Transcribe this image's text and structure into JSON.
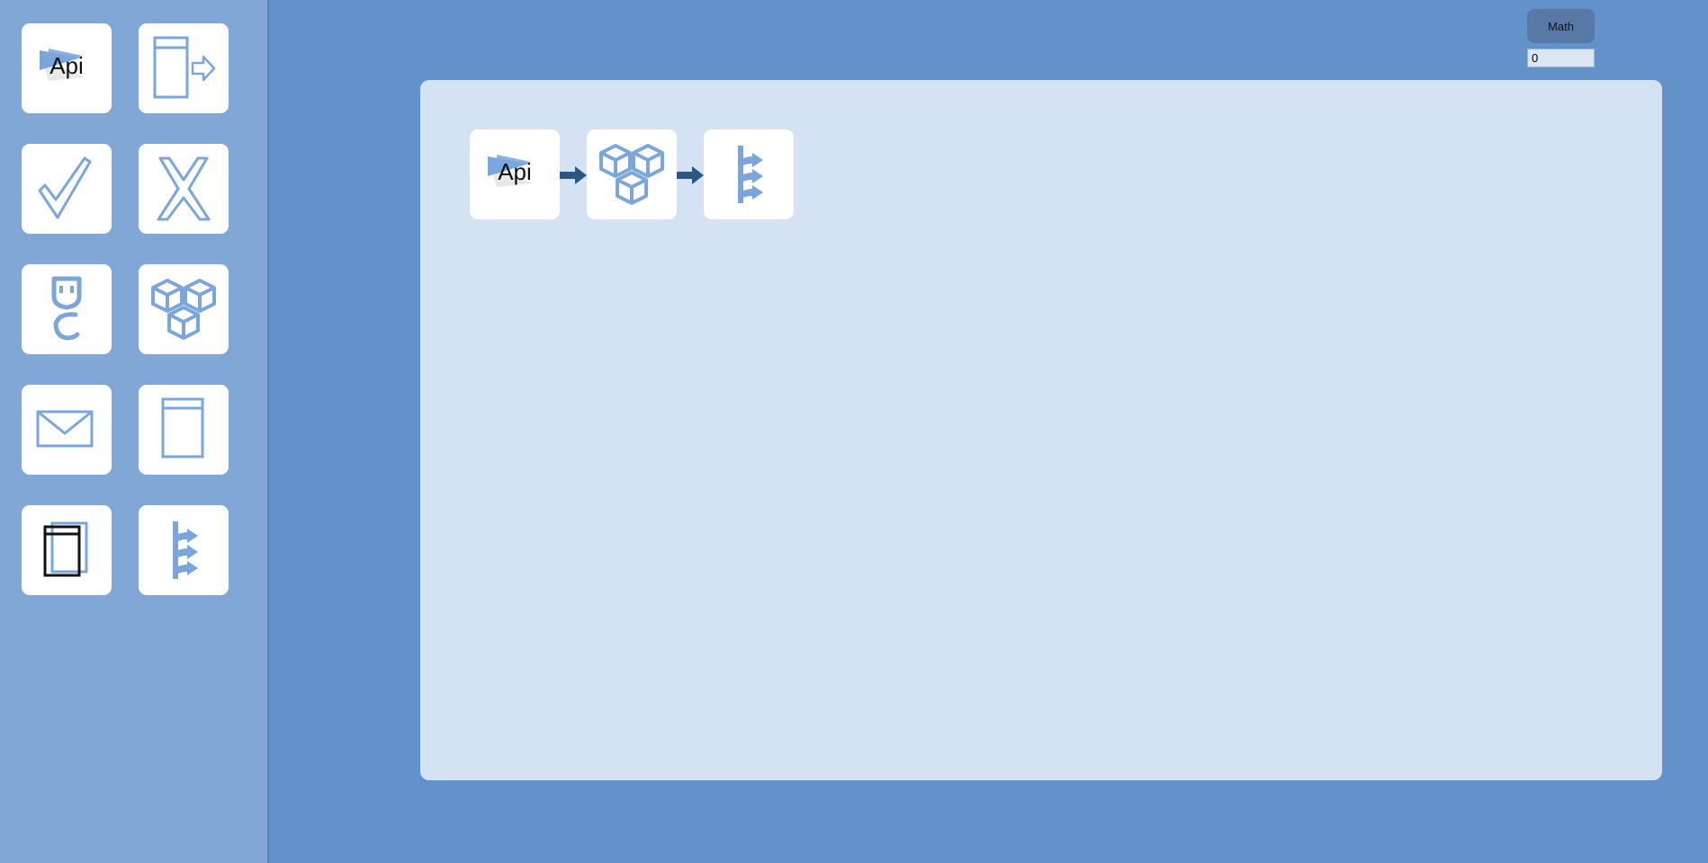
{
  "palette": {
    "page_bg": "#6391c9",
    "sidebar_bg": "#81a7d6",
    "canvas_bg": "#d5e2f3",
    "tile_bg": "#ffffff",
    "icon_stroke": "#7aa6dc",
    "connector": "#2c5785",
    "math_button_bg": "#5879a6"
  },
  "toolbar": {
    "math_label": "Math",
    "math_value": "0"
  },
  "palette_tiles": [
    {
      "icon": "api-icon",
      "label": "Api"
    },
    {
      "icon": "output-panel-icon"
    },
    {
      "icon": "check-icon"
    },
    {
      "icon": "cross-icon"
    },
    {
      "icon": "plug-icon"
    },
    {
      "icon": "cubes-icon"
    },
    {
      "icon": "mail-icon"
    },
    {
      "icon": "document-icon"
    },
    {
      "icon": "document-copy-icon"
    },
    {
      "icon": "split-arrows-icon"
    }
  ],
  "flow": {
    "nodes": [
      {
        "icon": "api-icon",
        "label": "Api"
      },
      {
        "icon": "cubes-icon"
      },
      {
        "icon": "split-arrows-icon"
      }
    ],
    "connectors": 2
  }
}
